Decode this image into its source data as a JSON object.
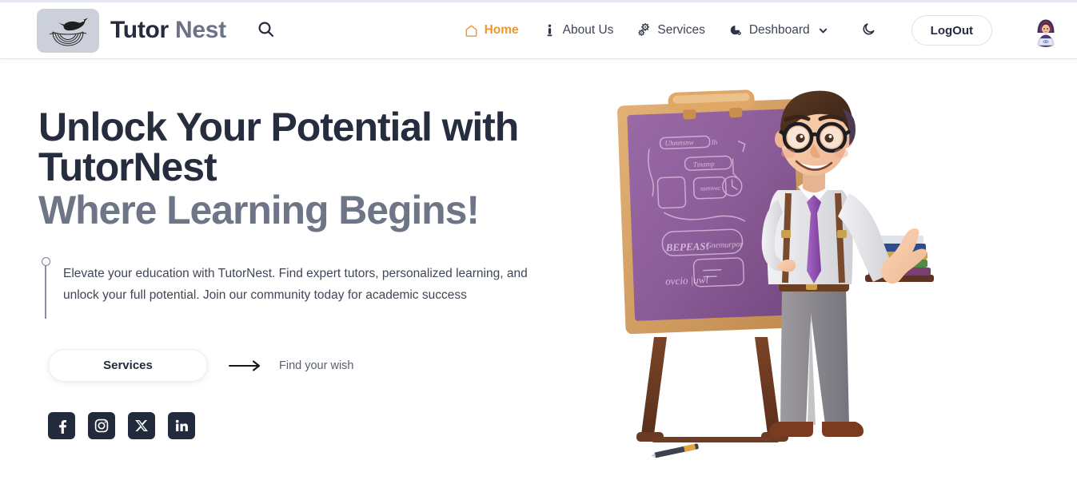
{
  "brand": {
    "logo_icon": "bird-in-nest-icon",
    "name_part1": "Tutor",
    "name_part2": "Nest"
  },
  "header": {
    "search_icon": "search-icon",
    "theme_toggle_icon": "moon-icon",
    "logout_label": "LogOut",
    "avatar_icon": "user-avatar-icon",
    "nav": [
      {
        "label": "Home",
        "icon": "home-icon",
        "active": true
      },
      {
        "label": "About Us",
        "icon": "info-person-icon",
        "active": false
      },
      {
        "label": "Services",
        "icon": "gears-icon",
        "active": false
      },
      {
        "label": "Deshboard",
        "icon": "pie-chart-icon",
        "active": false,
        "chevron": "chevron-down-icon"
      }
    ]
  },
  "hero": {
    "headline_line1": "Unlock Your Potential with",
    "headline_line2": "TutorNest",
    "headline_line3": "Where Learning Begins!",
    "lead": "Elevate your education with TutorNest. Find expert tutors, personalized learning, and unlock your full potential. Join our community today for academic success",
    "cta_label": "Services",
    "cta_arrow_icon": "arrow-right-icon",
    "cta_hint": "Find your wish",
    "socials": [
      {
        "name": "facebook",
        "icon": "facebook-icon"
      },
      {
        "name": "instagram",
        "icon": "instagram-icon"
      },
      {
        "name": "x-twitter",
        "icon": "x-twitter-icon"
      },
      {
        "name": "linkedin",
        "icon": "linkedin-icon"
      }
    ],
    "illustration": "teacher-with-chalkboard-illustration"
  },
  "colors": {
    "accent": "#f0962f",
    "heading_dark": "#252d3e",
    "heading_gray": "#6e7586",
    "social_tile": "#222b3c",
    "chalkboard": "#8a5b96",
    "logo_tile": "#ccd0da"
  }
}
